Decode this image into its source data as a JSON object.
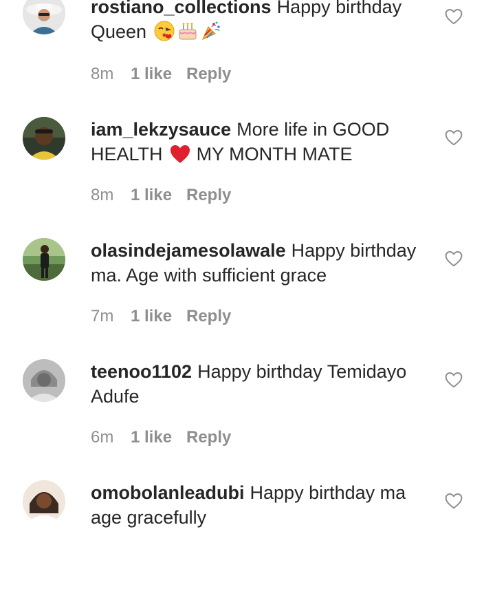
{
  "comments": [
    {
      "username": "rostiano_collections",
      "text": "Happy birthday Queen",
      "emojis": [
        "kiss-emoji",
        "cake-emoji",
        "party-popper-emoji"
      ],
      "time": "8m",
      "likes": "1 like",
      "reply_label": "Reply"
    },
    {
      "username": "iam_lekzysauce",
      "text_before": "More life in GOOD HEALTH",
      "emoji": "red-heart-emoji",
      "text_after": "MY MONTH MATE",
      "time": "8m",
      "likes": "1 like",
      "reply_label": "Reply"
    },
    {
      "username": "olasindejamesolawale",
      "text": "Happy birthday ma. Age with sufficient grace",
      "time": "7m",
      "likes": "1 like",
      "reply_label": "Reply"
    },
    {
      "username": "teenoo1102",
      "text": "Happy birthday Temidayo Adufe",
      "time": "6m",
      "likes": "1 like",
      "reply_label": "Reply"
    },
    {
      "username": "omobolanleadubi",
      "text": "Happy birthday ma age gracefully"
    }
  ],
  "icons": {
    "like": "heart-outline-icon"
  },
  "colors": {
    "text": "#262626",
    "meta": "#8e8e8e",
    "heart_outline": "#8e8e8e",
    "emoji_heart": "#e0202e"
  }
}
